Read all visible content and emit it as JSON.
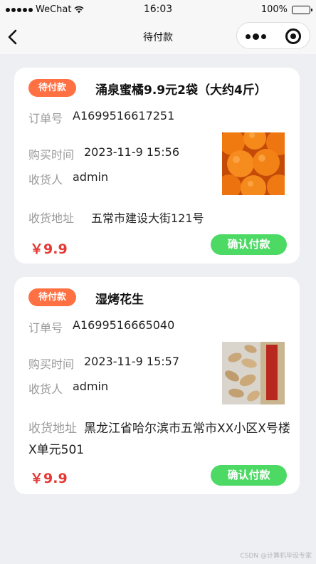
{
  "status_bar": {
    "carrier": "WeChat",
    "time": "16:03",
    "battery": "100%",
    "battery_level": 1.0
  },
  "nav": {
    "title": "待付款"
  },
  "orders": [
    {
      "tag": "待付款",
      "product_name": "涌泉蜜橘9.9元2袋（大约4斤）",
      "order_no_label": "订单号",
      "order_no": "A1699516617251",
      "purchase_time_label": "购买时间",
      "purchase_time": "2023-11-9 15:56",
      "receiver_label": "收货人",
      "receiver": "admin",
      "address_label": "收货地址",
      "address": "五常市建设大街121号",
      "price": "￥9.9",
      "pay_button": "确认付款"
    },
    {
      "tag": "待付款",
      "product_name": "湿烤花生",
      "order_no_label": "订单号",
      "order_no": "A1699516665040",
      "purchase_time_label": "购买时间",
      "purchase_time": "2023-11-9 15:57",
      "receiver_label": "收货人",
      "receiver": "admin",
      "address_label": "收货地址",
      "address": "黑龙江省哈尔滨市五常市XX小区X号楼X单元501",
      "price": "￥9.9",
      "pay_button": "确认付款"
    }
  ],
  "watermark": "CSDN @计算机毕设专家",
  "colors": {
    "tag_bg": "#ff7043",
    "price": "#e53935",
    "pay_button_bg": "#4cd964",
    "page_bg": "#eeeff3"
  }
}
